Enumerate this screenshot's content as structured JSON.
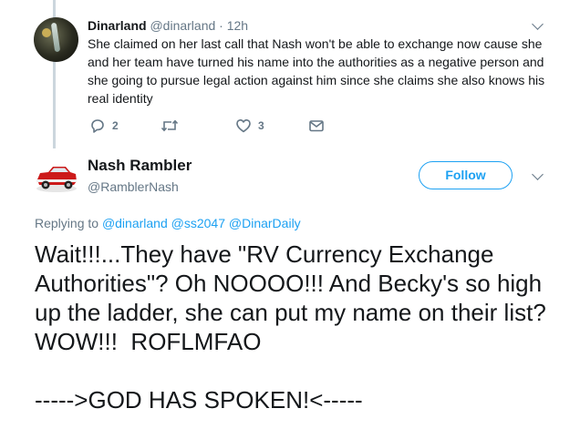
{
  "reply": {
    "display_name": "Dinarland",
    "handle": "@dinarland",
    "separator": " · ",
    "time": "12h",
    "text": "She claimed on her last call that Nash won't be able to exchange now cause she and her team have turned his name into the authorities as a negative person and she going to pursue legal action against him since she claims she also knows his real identity",
    "reply_count": "2",
    "like_count": "3",
    "icons": [
      "reply-icon",
      "retweet-icon",
      "heart-icon",
      "envelope-icon",
      "chevron-down-icon"
    ]
  },
  "tweet": {
    "display_name": "Nash Rambler",
    "handle": "@RamblerNash",
    "follow_label": "Follow",
    "replying_prefix": "Replying to",
    "mentions": [
      "@dinarland",
      "@ss2047",
      "@DinarDaily"
    ],
    "body_line1": "Wait!!!...They have \"RV Currency Exchange Authorities\"? Oh NOOOO!!! And Becky's so high up the ladder, she can put my name on their list? WOW!!!  ROFLMFAO",
    "body_line2": "----->GOD HAS SPOKEN!<-----",
    "icons": [
      "avatar-car-icon",
      "chevron-down-icon"
    ]
  },
  "colors": {
    "link": "#1da1f2",
    "muted": "#657786",
    "text": "#14171a",
    "thread_line": "#ccd6dd"
  }
}
